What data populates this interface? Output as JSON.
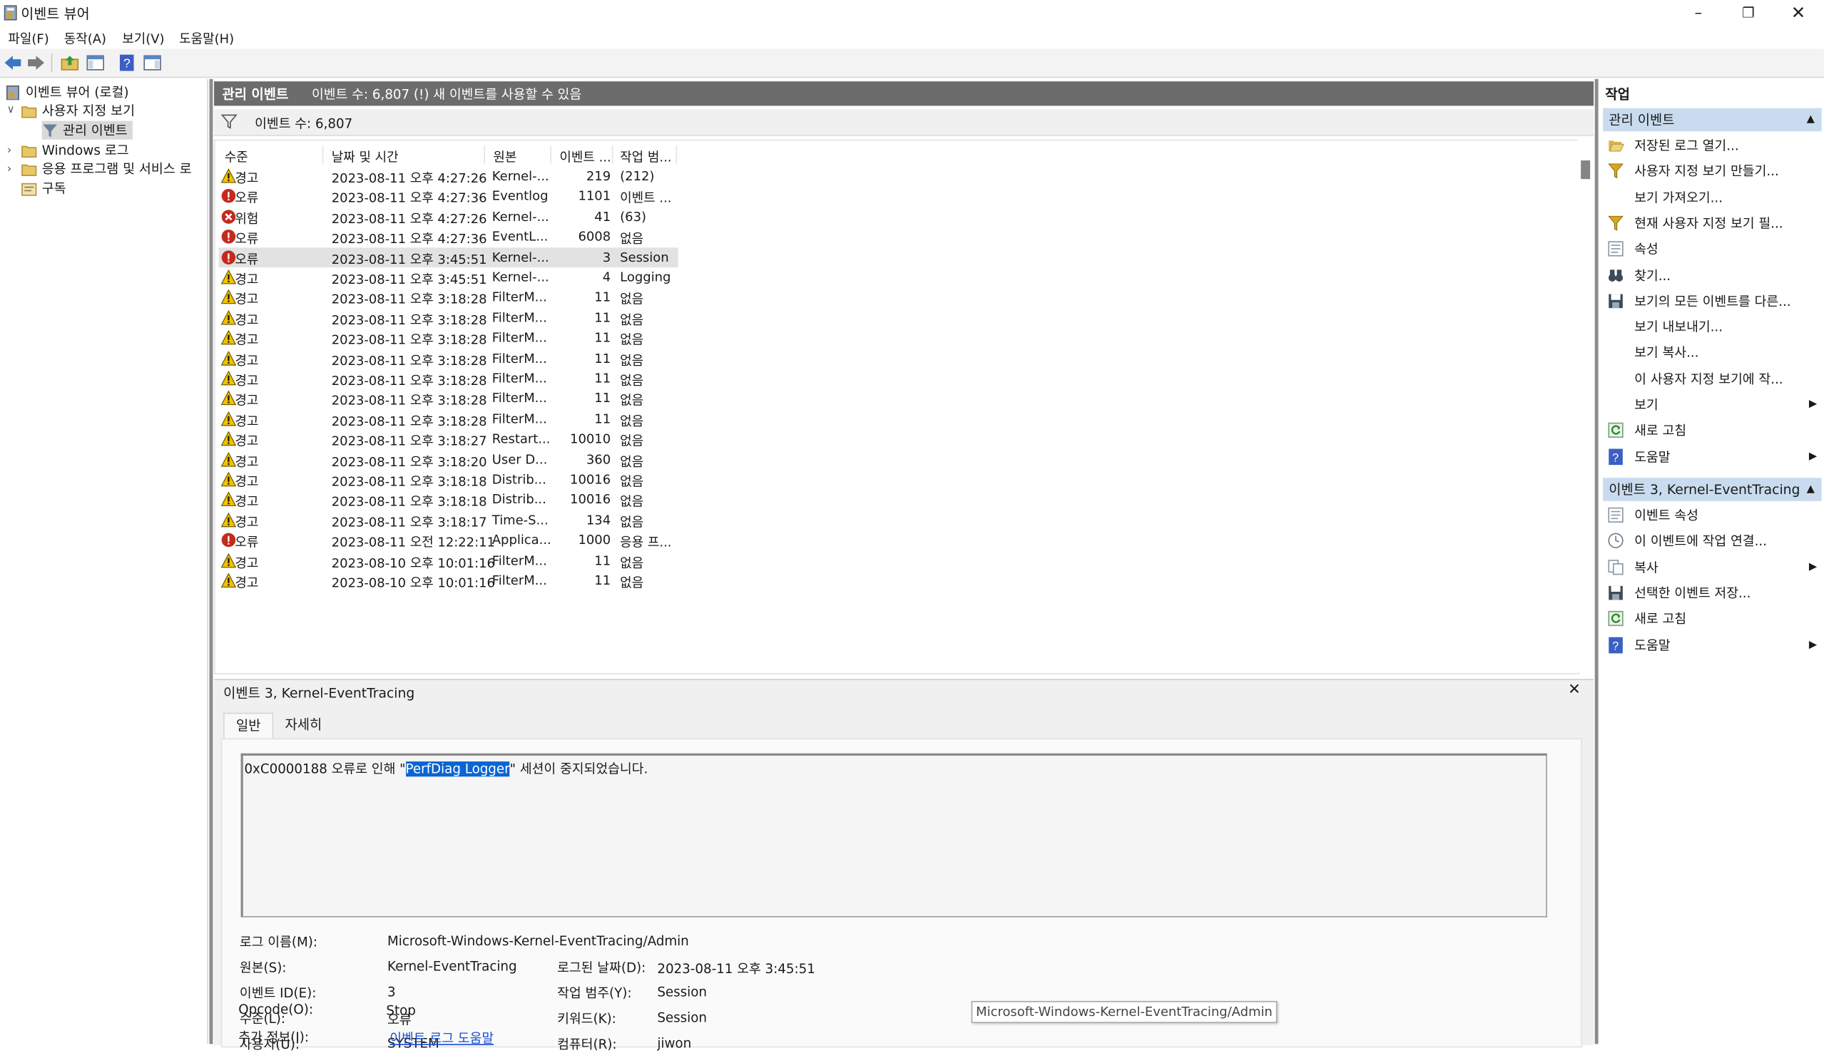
{
  "window": {
    "title": "이벤트 뷰어",
    "controls": [
      "minimize-icon",
      "restore-icon",
      "close-icon"
    ]
  },
  "menu": [
    "파일(F)",
    "동작(A)",
    "보기(V)",
    "도움말(H)"
  ],
  "tree": {
    "root": "이벤트 뷰어 (로컬)",
    "custom_views": "사용자 지정 보기",
    "admin_events": "관리 이벤트",
    "windows_logs": "Windows 로그",
    "app_service_logs": "응용 프로그램 및 서비스 로",
    "subscriptions": "구독"
  },
  "center": {
    "header_title": "관리 이벤트",
    "header_info": "이벤트 수: 6,807 (!) 새 이벤트를 사용할 수 있음",
    "filter_count": "이벤트 수: 6,807",
    "columns": [
      "수준",
      "날짜 및 시간",
      "원본",
      "이벤트 ...",
      "작업 범..."
    ],
    "rows": [
      {
        "level": "경고",
        "type": "warning",
        "datetime": "2023-08-11 오후 4:27:26",
        "source": "Kernel-...",
        "id": "219",
        "task": "(212)"
      },
      {
        "level": "오류",
        "type": "error",
        "datetime": "2023-08-11 오후 4:27:36",
        "source": "Eventlog",
        "id": "1101",
        "task": "이벤트 ..."
      },
      {
        "level": "위험",
        "type": "critical",
        "datetime": "2023-08-11 오후 4:27:26",
        "source": "Kernel-...",
        "id": "41",
        "task": "(63)"
      },
      {
        "level": "오류",
        "type": "error",
        "datetime": "2023-08-11 오후 4:27:36",
        "source": "EventL...",
        "id": "6008",
        "task": "없음"
      },
      {
        "level": "오류",
        "type": "error",
        "datetime": "2023-08-11 오후 3:45:51",
        "source": "Kernel-...",
        "id": "3",
        "task": "Session",
        "selected": true
      },
      {
        "level": "경고",
        "type": "warning",
        "datetime": "2023-08-11 오후 3:45:51",
        "source": "Kernel-...",
        "id": "4",
        "task": "Logging"
      },
      {
        "level": "경고",
        "type": "warning",
        "datetime": "2023-08-11 오후 3:18:28",
        "source": "FilterM...",
        "id": "11",
        "task": "없음"
      },
      {
        "level": "경고",
        "type": "warning",
        "datetime": "2023-08-11 오후 3:18:28",
        "source": "FilterM...",
        "id": "11",
        "task": "없음"
      },
      {
        "level": "경고",
        "type": "warning",
        "datetime": "2023-08-11 오후 3:18:28",
        "source": "FilterM...",
        "id": "11",
        "task": "없음"
      },
      {
        "level": "경고",
        "type": "warning",
        "datetime": "2023-08-11 오후 3:18:28",
        "source": "FilterM...",
        "id": "11",
        "task": "없음"
      },
      {
        "level": "경고",
        "type": "warning",
        "datetime": "2023-08-11 오후 3:18:28",
        "source": "FilterM...",
        "id": "11",
        "task": "없음"
      },
      {
        "level": "경고",
        "type": "warning",
        "datetime": "2023-08-11 오후 3:18:28",
        "source": "FilterM...",
        "id": "11",
        "task": "없음"
      },
      {
        "level": "경고",
        "type": "warning",
        "datetime": "2023-08-11 오후 3:18:28",
        "source": "FilterM...",
        "id": "11",
        "task": "없음"
      },
      {
        "level": "경고",
        "type": "warning",
        "datetime": "2023-08-11 오후 3:18:27",
        "source": "Restart...",
        "id": "10010",
        "task": "없음"
      },
      {
        "level": "경고",
        "type": "warning",
        "datetime": "2023-08-11 오후 3:18:20",
        "source": "User D...",
        "id": "360",
        "task": "없음"
      },
      {
        "level": "경고",
        "type": "warning",
        "datetime": "2023-08-11 오후 3:18:18",
        "source": "Distrib...",
        "id": "10016",
        "task": "없음"
      },
      {
        "level": "경고",
        "type": "warning",
        "datetime": "2023-08-11 오후 3:18:18",
        "source": "Distrib...",
        "id": "10016",
        "task": "없음"
      },
      {
        "level": "경고",
        "type": "warning",
        "datetime": "2023-08-11 오후 3:18:17",
        "source": "Time-S...",
        "id": "134",
        "task": "없음"
      },
      {
        "level": "오류",
        "type": "error",
        "datetime": "2023-08-11 오전 12:22:11",
        "source": "Applica...",
        "id": "1000",
        "task": "응용 프..."
      },
      {
        "level": "경고",
        "type": "warning",
        "datetime": "2023-08-10 오후 10:01:16",
        "source": "FilterM...",
        "id": "11",
        "task": "없음"
      },
      {
        "level": "경고",
        "type": "warning",
        "datetime": "2023-08-10 오후 10:01:16",
        "source": "FilterM...",
        "id": "11",
        "task": "없음"
      }
    ]
  },
  "detail": {
    "title": "이벤트 3, Kernel-EventTracing",
    "tabs": [
      "일반",
      "자세히"
    ],
    "message_before": "0xC0000188 오류로 인해 \"",
    "message_selected": "PerfDiag Logger",
    "message_after": "\" 세션이 중지되었습니다.",
    "fields": {
      "log_name_label": "로그 이름(M):",
      "log_name": "Microsoft-Windows-Kernel-EventTracing/Admin",
      "source_label": "원본(S):",
      "source": "Kernel-EventTracing",
      "logged_label": "로그된 날짜(D):",
      "logged": "2023-08-11 오후 3:45:51",
      "event_id_label": "이벤트 ID(E):",
      "event_id": "3",
      "task_label": "작업 범주(Y):",
      "task": "Session",
      "level_label": "수준(L):",
      "level": "오류",
      "keywords_label": "키워드(K):",
      "keywords": "Session",
      "user_label": "사용자(U):",
      "user": "SYSTEM",
      "computer_label": "컴퓨터(R):",
      "computer": "jiwon",
      "opcode_label": "Opcode(O):",
      "opcode": "Stop",
      "more_info_label": "추가 정보(I):",
      "more_info_link": "이벤트 로그 도움말"
    },
    "tooltip": "Microsoft-Windows-Kernel-EventTracing/Admin"
  },
  "actions": {
    "title": "작업",
    "section1": "관리 이벤트",
    "items1": [
      {
        "label": "저장된 로그 열기...",
        "icon": "folder-open-icon"
      },
      {
        "label": "사용자 지정 보기 만들기...",
        "icon": "filter-icon"
      },
      {
        "label": "보기 가져오기...",
        "icon": ""
      },
      {
        "label": "현재 사용자 지정 보기 필...",
        "icon": "filter-icon"
      },
      {
        "label": "속성",
        "icon": "properties-icon"
      },
      {
        "label": "찾기...",
        "icon": "binoculars-icon"
      },
      {
        "label": "보기의 모든 이벤트를 다른...",
        "icon": "save-icon"
      },
      {
        "label": "보기 내보내기...",
        "icon": ""
      },
      {
        "label": "보기 복사...",
        "icon": ""
      },
      {
        "label": "이 사용자 지정 보기에 작...",
        "icon": ""
      },
      {
        "label": "보기",
        "icon": "",
        "submenu": true
      },
      {
        "label": "새로 고침",
        "icon": "refresh-icon"
      },
      {
        "label": "도움말",
        "icon": "help-icon",
        "submenu": true
      }
    ],
    "section2": "이벤트 3, Kernel-EventTracing",
    "items2": [
      {
        "label": "이벤트 속성",
        "icon": "properties-icon"
      },
      {
        "label": "이 이벤트에 작업 연결...",
        "icon": "task-icon"
      },
      {
        "label": "복사",
        "icon": "copy-icon",
        "submenu": true
      },
      {
        "label": "선택한 이벤트 저장...",
        "icon": "save-icon"
      },
      {
        "label": "새로 고침",
        "icon": "refresh-icon"
      },
      {
        "label": "도움말",
        "icon": "help-icon",
        "submenu": true
      }
    ]
  }
}
